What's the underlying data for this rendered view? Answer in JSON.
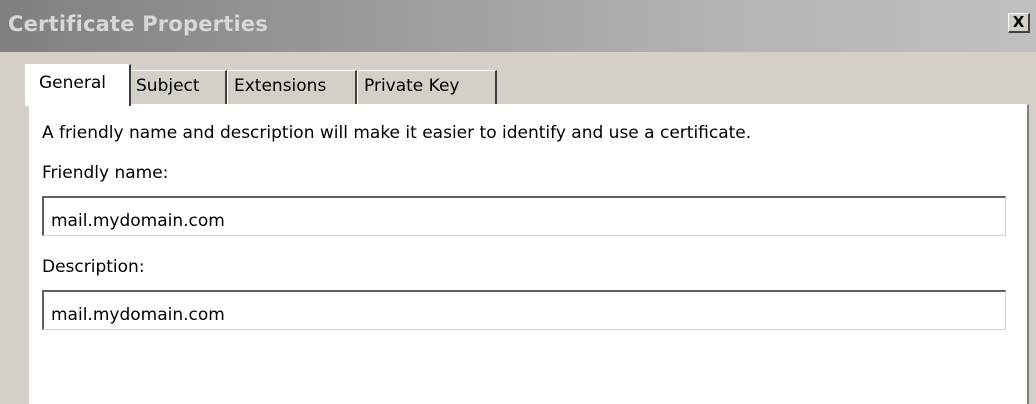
{
  "window": {
    "title": "Certificate Properties",
    "close_label": "X"
  },
  "tabs": [
    {
      "label": "General",
      "active": true
    },
    {
      "label": "Subject",
      "active": false
    },
    {
      "label": "Extensions",
      "active": false
    },
    {
      "label": "Private Key",
      "active": false
    }
  ],
  "general": {
    "intro": "A friendly name and description will make it easier to identify and use a certificate.",
    "friendly_name_label": "Friendly name:",
    "friendly_name_value": "mail.mydomain.com",
    "description_label": "Description:",
    "description_value": "mail.mydomain.com"
  }
}
